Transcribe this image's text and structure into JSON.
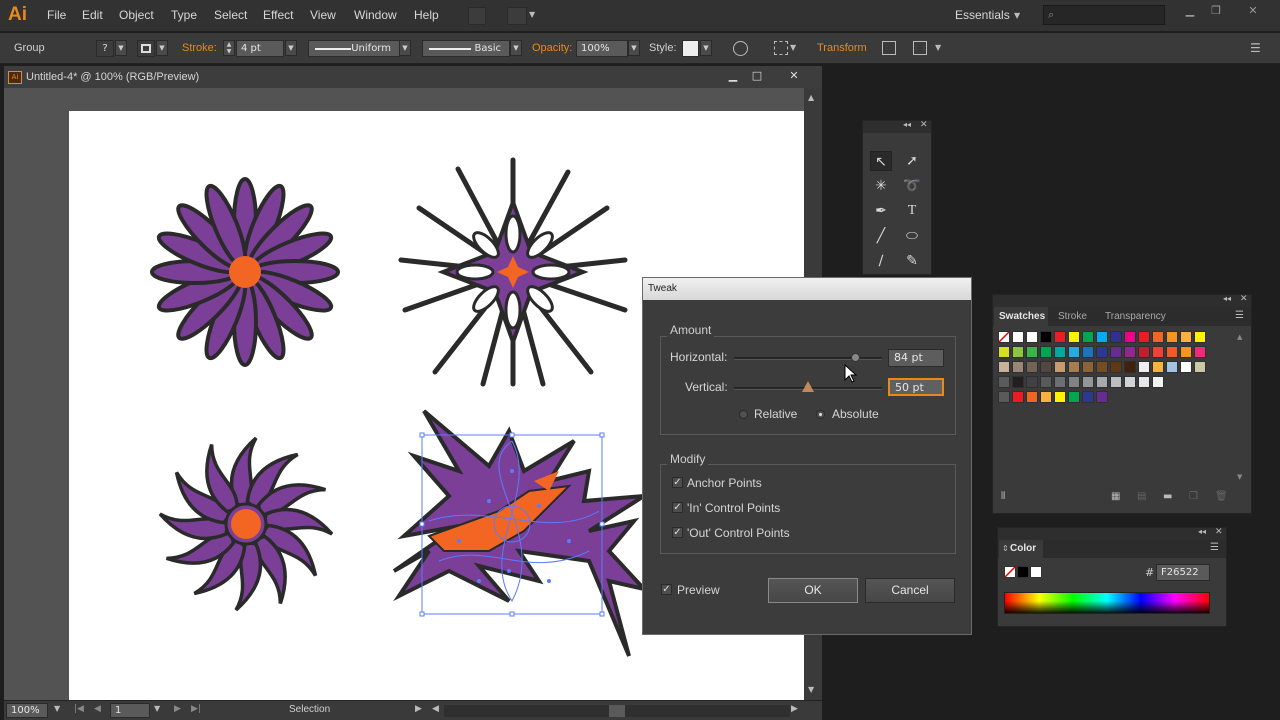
{
  "app": {
    "logo": "Ai"
  },
  "menu": [
    "File",
    "Edit",
    "Object",
    "Type",
    "Select",
    "Effect",
    "View",
    "Window",
    "Help"
  ],
  "workspace": "Essentials",
  "control_bar": {
    "selection_type": "Group",
    "stroke_label": "Stroke:",
    "stroke_weight": "4 pt",
    "stroke_profile": "Uniform",
    "brush": "Basic",
    "opacity_label": "Opacity:",
    "opacity_value": "100%",
    "style_label": "Style:",
    "transform_label": "Transform"
  },
  "document": {
    "title": "Untitled-4* @ 100% (RGB/Preview)",
    "zoom": "100%",
    "artboard_number": "1",
    "status": "Selection"
  },
  "tweak_dialog": {
    "title": "Tweak",
    "amount_label": "Amount",
    "horizontal_label": "Horizontal:",
    "horizontal_value": "84 pt",
    "horizontal_fraction": 0.82,
    "vertical_label": "Vertical:",
    "vertical_value": "50 pt",
    "vertical_fraction": 0.5,
    "relative_label": "Relative",
    "absolute_label": "Absolute",
    "modify_label": "Modify",
    "anchor_points_label": "Anchor Points",
    "in_points_label": "'In' Control Points",
    "out_points_label": "'Out' Control Points",
    "preview_label": "Preview",
    "ok_label": "OK",
    "cancel_label": "Cancel"
  },
  "swatches_panel": {
    "tabs": [
      "Swatches",
      "Stroke",
      "Transparency"
    ]
  },
  "color_panel": {
    "title": "Color",
    "hash": "#",
    "hex_value": "F26522"
  },
  "colors": {
    "accent": "#e8891b",
    "purple": "#7b3f98",
    "orange": "#f26522",
    "outline": "#2a2a2a"
  }
}
